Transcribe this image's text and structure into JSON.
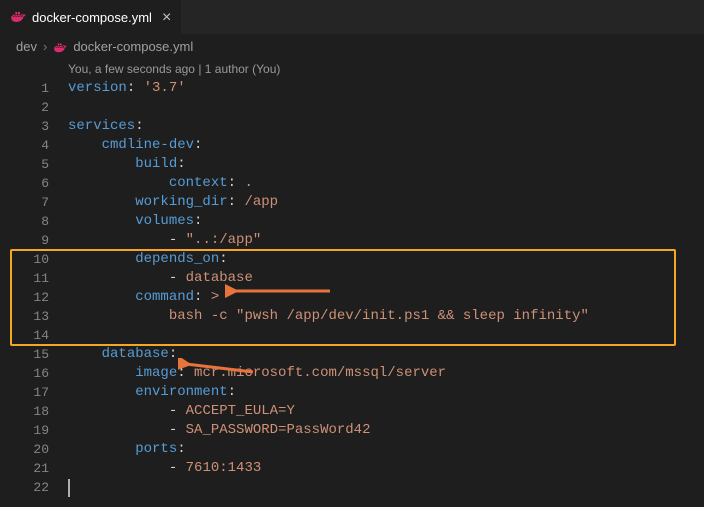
{
  "tab": {
    "filename": "docker-compose.yml",
    "close": "×"
  },
  "breadcrumbs": {
    "folder": "dev",
    "sep": "›",
    "file": "docker-compose.yml"
  },
  "codelens": "You, a few seconds ago | 1 author (You)",
  "lines": {
    "1": {
      "num": "1",
      "a": "version",
      "b": ": ",
      "c": "'3.7'"
    },
    "2": {
      "num": "2"
    },
    "3": {
      "num": "3",
      "a": "services",
      "b": ":"
    },
    "4": {
      "num": "4",
      "a": "cmdline-dev",
      "b": ":"
    },
    "5": {
      "num": "5",
      "a": "build",
      "b": ":"
    },
    "6": {
      "num": "6",
      "a": "context",
      "b": ": ",
      "c": "."
    },
    "7": {
      "num": "7",
      "a": "working_dir",
      "b": ": ",
      "c": "/app"
    },
    "8": {
      "num": "8",
      "a": "volumes",
      "b": ":"
    },
    "9": {
      "num": "9",
      "a": "- ",
      "c": "\"..:/app\""
    },
    "10": {
      "num": "10",
      "a": "depends_on",
      "b": ":"
    },
    "11": {
      "num": "11",
      "a": "- ",
      "c": "database"
    },
    "12": {
      "num": "12",
      "a": "command",
      "b": ": ",
      "c": ">"
    },
    "13": {
      "num": "13",
      "c": "bash -c \"pwsh /app/dev/init.ps1 && sleep infinity\""
    },
    "14": {
      "num": "14"
    },
    "15": {
      "num": "15",
      "a": "database",
      "b": ":"
    },
    "16": {
      "num": "16",
      "a": "image",
      "b": ": ",
      "c": "mcr.microsoft.com/mssql/server"
    },
    "17": {
      "num": "17",
      "a": "environment",
      "b": ":"
    },
    "18": {
      "num": "18",
      "a": "- ",
      "c": "ACCEPT_EULA=Y"
    },
    "19": {
      "num": "19",
      "a": "- ",
      "c": "SA_PASSWORD=PassWord42"
    },
    "20": {
      "num": "20",
      "a": "ports",
      "b": ":"
    },
    "21": {
      "num": "21",
      "a": "- ",
      "c": "7610:1433"
    },
    "22": {
      "num": "22"
    }
  }
}
